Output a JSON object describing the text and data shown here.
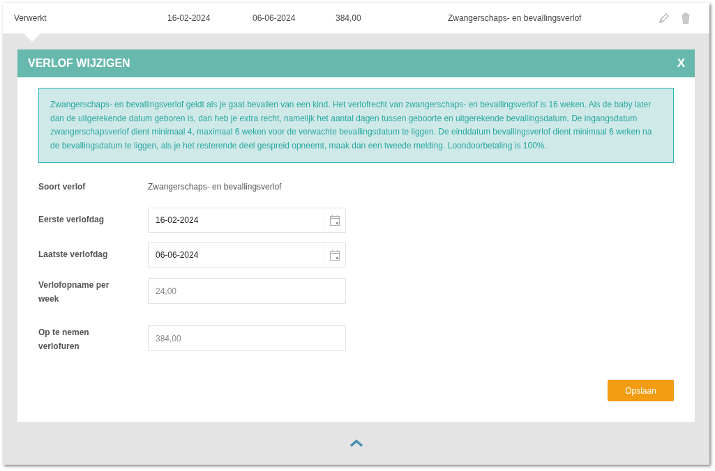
{
  "row": {
    "status": "Verwerkt",
    "start": "16-02-2024",
    "end": "06-06-2024",
    "hours": "384,00",
    "type": "Zwangerschaps- en bevallingsverlof"
  },
  "dialog": {
    "title": "VERLOF WIJZIGEN",
    "close": "X",
    "info": "Zwangerschaps- en bevallingsverlof geldt als je gaat bevallen van een kind. Het verlofrecht van zwangerschaps- en bevallingsverlof is 16 weken. Als de baby later dan de uitgerekende datum geboren is, dan heb je extra recht, namelijk het aantal dagen tussen geboorte en uitgerekende bevallingsdatum. De ingangsdatum zwangerschapsverlof dient minimaal 4, maximaal 6 weken voor de verwachte bevallingsdatum te liggen. De einddatum bevallingsverlof dient minimaal 6 weken na de bevallingsdatum te liggen, als je het resterende deel gespreid opneemt, maak dan een tweede melding. Loondoorbetaling is 100%.",
    "fields": [
      {
        "kind": "text",
        "label": "Soort verlof",
        "value": "Zwangerschaps- en bevallingsverlof"
      },
      {
        "kind": "date",
        "label": "Eerste verlofdag",
        "value": "16-02-2024"
      },
      {
        "kind": "date",
        "label": "Laatste verlofdag",
        "value": "06-06-2024"
      },
      {
        "kind": "number",
        "label": "Verlofopname per week",
        "value": "24,00"
      },
      {
        "kind": "number",
        "label": "Op te nemen verlofuren",
        "value": "384,00"
      }
    ],
    "save": "Opslaan"
  }
}
